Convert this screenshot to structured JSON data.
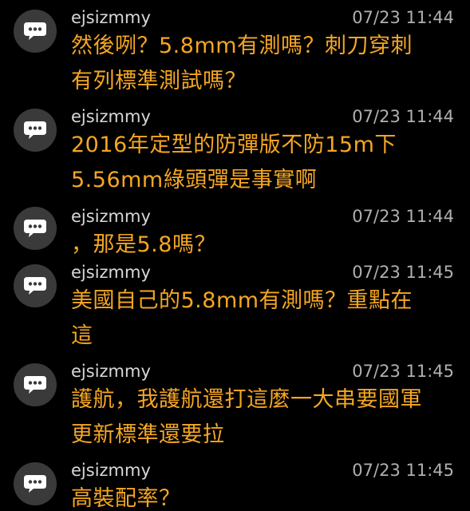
{
  "comments": [
    {
      "author": "ejsizmmy",
      "time": "07/23 11:44",
      "lines": [
        "然後咧？5.8mm有測嗎？刺刀穿刺",
        "有列標準測試嗎？"
      ]
    },
    {
      "author": "ejsizmmy",
      "time": "07/23 11:44",
      "lines": [
        "2016年定型的防彈版不防15m下",
        "5.56mm綠頭彈是事實啊"
      ]
    },
    {
      "author": "ejsizmmy",
      "time": "07/23 11:44",
      "lines": [
        "，那是5.8嗎？"
      ]
    },
    {
      "author": "ejsizmmy",
      "time": "07/23 11:45",
      "lines": [
        "美國自己的5.8mm有測嗎？重點在",
        "這"
      ]
    },
    {
      "author": "ejsizmmy",
      "time": "07/23 11:45",
      "lines": [
        "護航，我護航還打這麼一大串要國軍",
        "更新標準還要拉"
      ]
    },
    {
      "author": "ejsizmmy",
      "time": "07/23 11:45",
      "lines": [
        "高裝配率？"
      ]
    }
  ],
  "avatar_icon": "speech-bubble-icon",
  "colors": {
    "background": "#000000",
    "author": "#d8d8d8",
    "time": "#b0b0b0",
    "body": "#f5a623",
    "avatar_bg": "#3a3a3a"
  }
}
